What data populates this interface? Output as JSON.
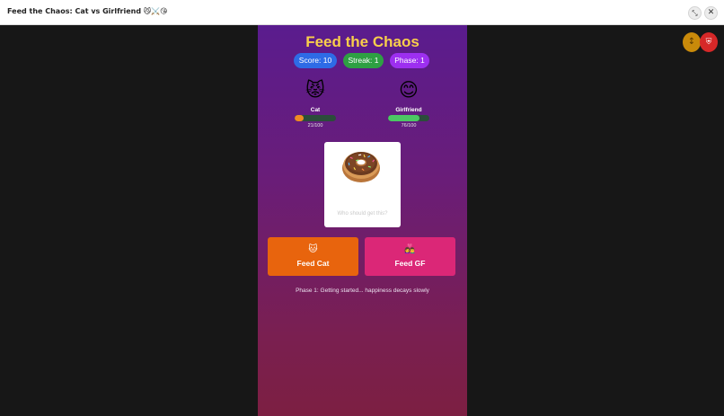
{
  "window": {
    "title": "Feed the Chaos: Cat vs Girlfriend 😼⚔️😘",
    "collapse_glyph": "⤡",
    "close_glyph": "✕"
  },
  "floating": {
    "left_glyph": "↕",
    "right_glyph": "⛨"
  },
  "game": {
    "title": "Feed the Chaos",
    "score_label": "Score: 10",
    "streak_label": "Streak: 1",
    "phase_label": "Phase: 1",
    "cat": {
      "emoji": "😾",
      "name": "Cat",
      "happiness": 21,
      "value_text": "21/100"
    },
    "girlfriend": {
      "emoji": "😊",
      "name": "Girlfriend",
      "happiness": 76,
      "value_text": "76/100"
    },
    "food_card": {
      "item_icon": "donut-icon",
      "hint": "Who should get this?"
    },
    "buttons": {
      "feed_cat_icon": "🐱",
      "feed_cat_label": "Feed Cat",
      "feed_gf_icon": "👩‍❤️‍👨",
      "feed_gf_label": "Feed GF"
    },
    "phase_message": "Phase 1: Getting started... happiness decays slowly"
  },
  "colors": {
    "title": "#f9cf4b",
    "score_pill": "#2e6be6",
    "streak_pill": "#2ea043",
    "phase_pill": "#9d2ff0",
    "cat_bar": "#f08a24",
    "gf_bar": "#4cc764",
    "feed_cat_button": "#e8640d",
    "feed_gf_button": "#db2777"
  }
}
